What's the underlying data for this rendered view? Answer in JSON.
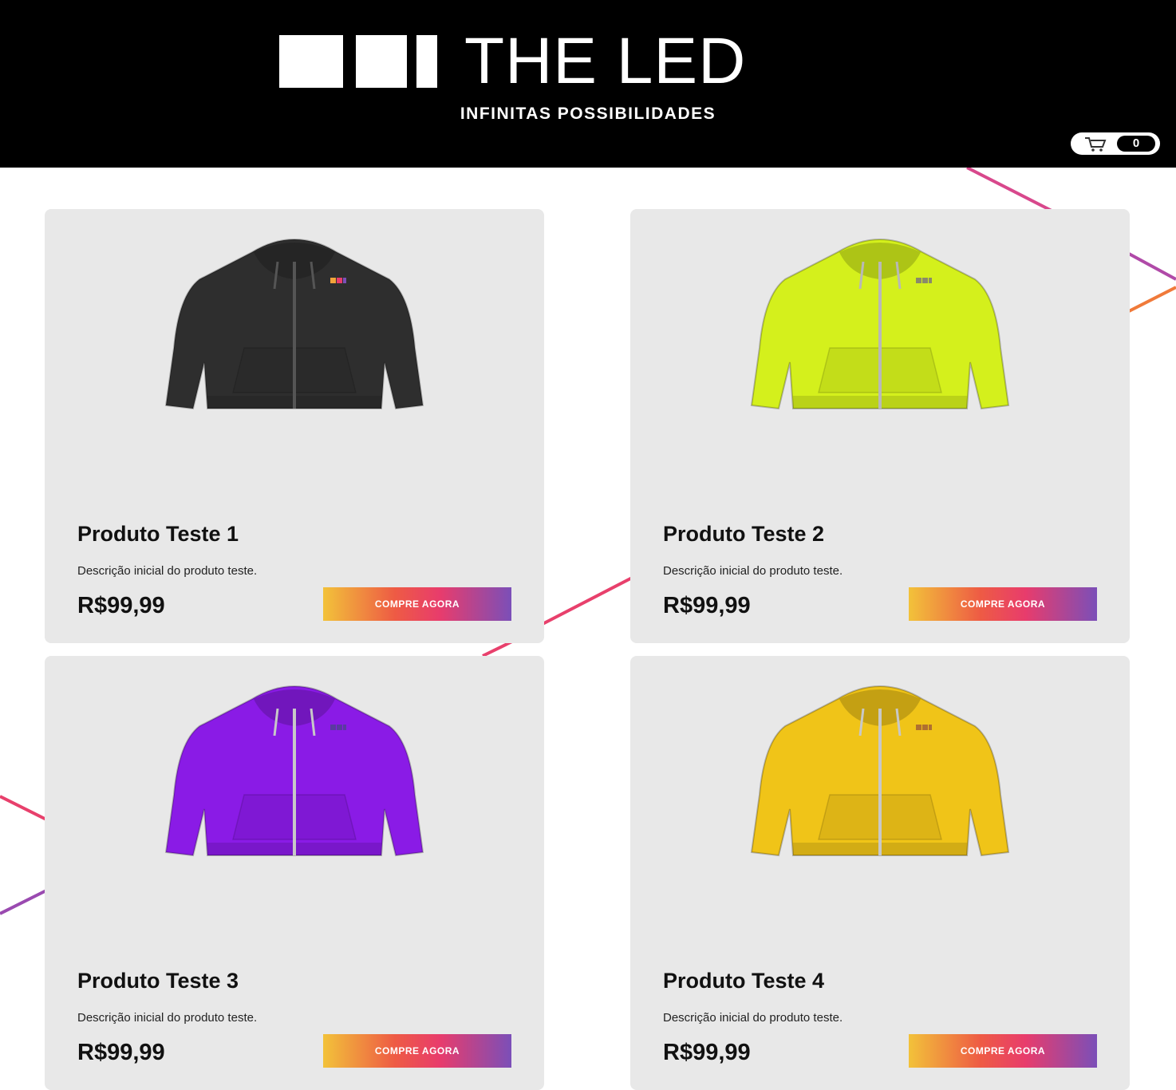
{
  "header": {
    "brand": "THE LED",
    "tagline": "INFINITAS POSSIBILIDADES",
    "cart_count": "0"
  },
  "colors": {
    "header_bg": "#000000",
    "card_bg": "#e8e8e8",
    "button_gradient": [
      "#f2c23a",
      "#ee5b44",
      "#e83c6c",
      "#7b4fb8"
    ]
  },
  "products": [
    {
      "title": "Produto Teste 1",
      "description": "Descrição inicial do produto teste.",
      "price": "R$99,99",
      "button_label": "COMPRE AGORA",
      "hoodie_color": "#2e2e2e",
      "zipper_color": "#555555",
      "badge_colors": [
        "#f2a33a",
        "#e83c6c",
        "#7b4fb8"
      ]
    },
    {
      "title": "Produto Teste 2",
      "description": "Descrição inicial do produto teste.",
      "price": "R$99,99",
      "button_label": "COMPRE AGORA",
      "hoodie_color": "#d4f01c",
      "zipper_color": "#b8b8b8",
      "badge_colors": [
        "#8a8a6a",
        "#8a8a6a",
        "#8a8a6a"
      ]
    },
    {
      "title": "Produto Teste 3",
      "description": "Descrição inicial do produto teste.",
      "price": "R$99,99",
      "button_label": "COMPRE AGORA",
      "hoodie_color": "#8a1be6",
      "zipper_color": "#c8c8c8",
      "badge_colors": [
        "#5a3aa0",
        "#5a3aa0",
        "#5a3aa0"
      ]
    },
    {
      "title": "Produto Teste 4",
      "description": "Descrição inicial do produto teste.",
      "price": "R$99,99",
      "button_label": "COMPRE AGORA",
      "hoodie_color": "#f0c418",
      "zipper_color": "#c8c8c8",
      "badge_colors": [
        "#b07030",
        "#b07030",
        "#b07030"
      ]
    }
  ]
}
